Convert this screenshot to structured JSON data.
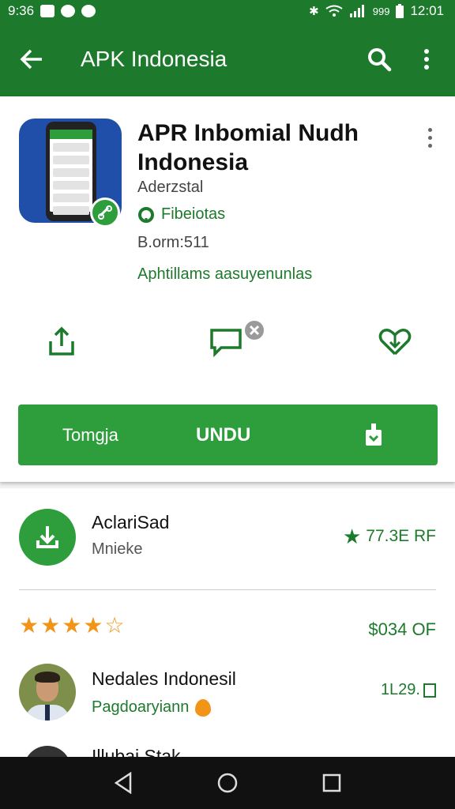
{
  "status_bar": {
    "time_left": "9:36",
    "time_right": "12:01",
    "network_text": "999",
    "icons": [
      "image-notification-icon",
      "messenger-icon",
      "circle-notification-icon",
      "bluetooth-icon",
      "wifi-icon",
      "signal-icon",
      "battery-icon"
    ]
  },
  "app_bar": {
    "title": "APK Indonesia",
    "icons": [
      "back-arrow-icon",
      "search-icon",
      "more-vert-icon"
    ]
  },
  "app": {
    "name": "APR Inbomial Nudh Indonesia",
    "developer": "Aderzstal",
    "tag": "Fibeiotas",
    "size": "B.orm:511",
    "description": "Aphtillams aasuyenunlas"
  },
  "actions": {
    "icons": [
      "share-icon",
      "comment-icon",
      "close-badge-icon",
      "download-heart-icon"
    ]
  },
  "install_bar": {
    "left_label": "Tomgja",
    "center_label": "UNDU",
    "right_icon": "install-icon"
  },
  "details": {
    "row1_title": "AclariSad",
    "row1_sub": "Mnieke",
    "row1_rating": "77.3E RF",
    "stars_filled": 4,
    "stars_total": 5,
    "price": "$034 OF",
    "person_name": "Nedales Indonesil",
    "person_sub": "Pagdoaryiann",
    "person_right": "1L29.",
    "peek_text": "Illubai Stak"
  },
  "nav": {
    "icons": [
      "back-triangle-icon",
      "home-circle-icon",
      "recents-square-icon"
    ]
  },
  "colors": {
    "primary": "#1d7a2c",
    "accent": "#2e9e3c",
    "star": "#f29418"
  }
}
